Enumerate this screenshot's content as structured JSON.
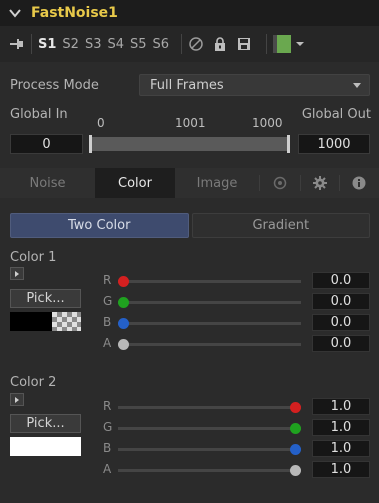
{
  "tool": {
    "name": "FastNoise1"
  },
  "toolbar": {
    "slots": [
      "S1",
      "S2",
      "S3",
      "S4",
      "S5",
      "S6"
    ],
    "active_slot": "S1",
    "swatch_color": "#6aa84f"
  },
  "process_mode": {
    "label": "Process Mode",
    "value": "Full Frames"
  },
  "global": {
    "in_label": "Global In",
    "out_label": "Global Out",
    "tick_start": "0",
    "tick_mid": "1001",
    "tick_end": "1000",
    "in_value": "0",
    "out_value": "1000"
  },
  "tabs": [
    {
      "label": "Noise",
      "active": false
    },
    {
      "label": "Color",
      "active": true
    },
    {
      "label": "Image",
      "active": false
    }
  ],
  "color_mode": {
    "options": [
      "Two Color",
      "Gradient"
    ],
    "selected": "Two Color"
  },
  "colors": [
    {
      "title": "Color 1",
      "pick_label": "Pick...",
      "channels": [
        {
          "name": "R",
          "value": "0.0",
          "color": "#d42020"
        },
        {
          "name": "G",
          "value": "0.0",
          "color": "#1fa21f"
        },
        {
          "name": "B",
          "value": "0.0",
          "color": "#2460c8"
        },
        {
          "name": "A",
          "value": "0.0",
          "color": "#b8b8b8"
        }
      ]
    },
    {
      "title": "Color 2",
      "pick_label": "Pick...",
      "channels": [
        {
          "name": "R",
          "value": "1.0",
          "color": "#d42020"
        },
        {
          "name": "G",
          "value": "1.0",
          "color": "#1fa21f"
        },
        {
          "name": "B",
          "value": "1.0",
          "color": "#2460c8"
        },
        {
          "name": "A",
          "value": "1.0",
          "color": "#b8b8b8"
        }
      ]
    }
  ],
  "icons": {
    "title": "chevron-down-icon",
    "pin": "pin-icon",
    "disable": "disable-icon",
    "lock": "lock-icon",
    "save": "save-icon",
    "menu_arrow": "dropdown-arrow-icon",
    "tab_extra": [
      "node-icon",
      "gear-icon",
      "info-icon"
    ]
  }
}
